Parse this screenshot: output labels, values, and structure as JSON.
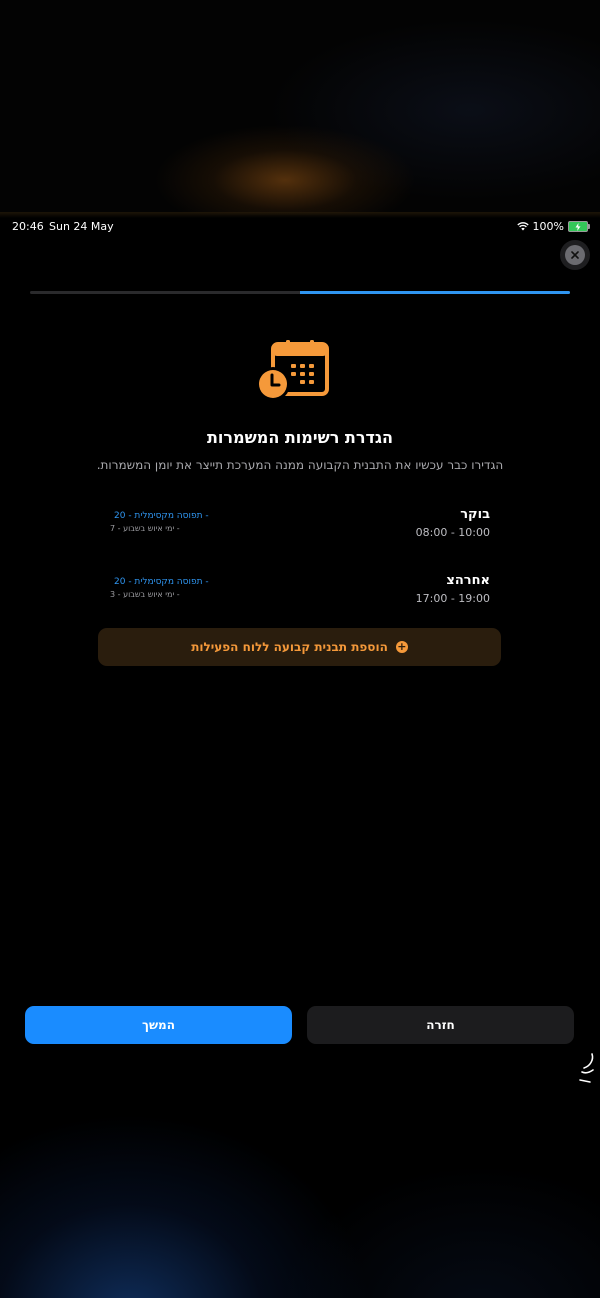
{
  "status_bar": {
    "time": "20:46",
    "date": "Sun 24 May",
    "battery": "100%"
  },
  "progress": {
    "fraction": 0.5,
    "color": "#2f95f0"
  },
  "header": {
    "title": "הגדרת רשימות המשמרות",
    "subtitle": "הגדירו כבר עכשיו את התבנית הקבועה ממנה המערכת תייצר את יומן המשמרות."
  },
  "shifts": [
    {
      "name": "בוקר",
      "time": "08:00 - 10:00",
      "capacity": "- תפוסה מקסימלית - 20",
      "days": "- ימי איוש בשבוע - 7"
    },
    {
      "name": "אחרהצ",
      "time": "17:00 - 19:00",
      "capacity": "- תפוסה מקסימלית - 20",
      "days": "- ימי איוש בשבוע - 3"
    }
  ],
  "add_template": {
    "label": "הוספת תבנית קבועה ללוח הפעילות",
    "icon": "plus-circle-icon"
  },
  "footer": {
    "continue_label": "המשך",
    "back_label": "חזרה"
  },
  "colors": {
    "accent_orange": "#f5993a",
    "accent_blue": "#1a8cff",
    "background": "#000000"
  }
}
